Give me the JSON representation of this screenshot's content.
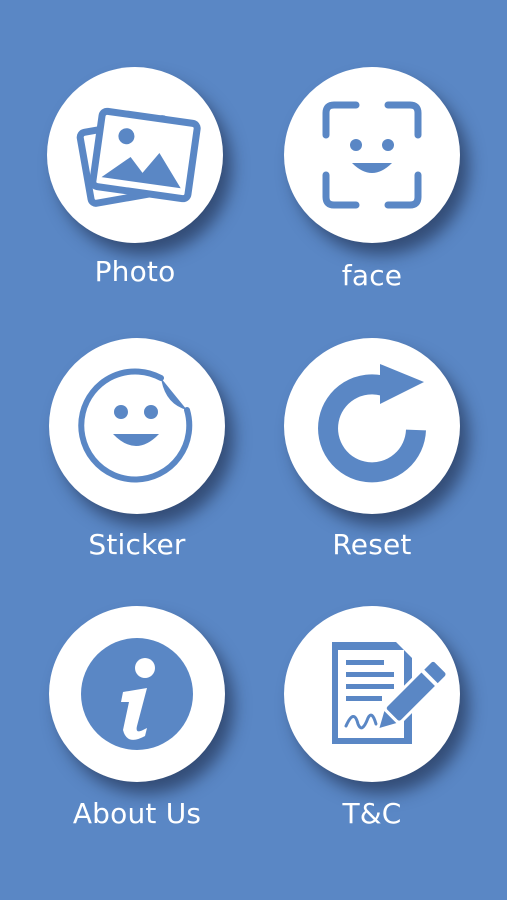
{
  "theme": {
    "background": "#5a87c5",
    "circle": "#ffffff",
    "icon": "#5a87c5",
    "label": "#ffffff"
  },
  "menu": {
    "photo": {
      "label": "Photo",
      "icon": "photo-icon"
    },
    "face": {
      "label": "face",
      "icon": "face-scan-icon"
    },
    "sticker": {
      "label": "Sticker",
      "icon": "sticker-icon"
    },
    "reset": {
      "label": "Reset",
      "icon": "reset-icon"
    },
    "about": {
      "label": "About Us",
      "icon": "info-icon"
    },
    "tc": {
      "label": "T&C",
      "icon": "document-sign-icon"
    }
  }
}
